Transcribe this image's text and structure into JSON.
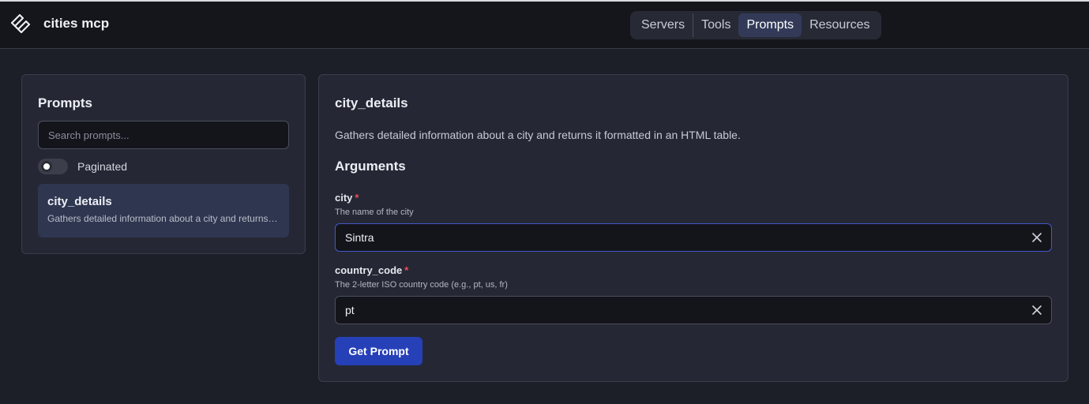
{
  "app": {
    "name": "cities mcp",
    "logo_icon": "layers-stack-icon"
  },
  "nav": {
    "items": [
      {
        "label": "Servers"
      },
      {
        "label": "Tools"
      },
      {
        "label": "Prompts"
      },
      {
        "label": "Resources"
      }
    ],
    "active": "Prompts"
  },
  "sidebar": {
    "title": "Prompts",
    "search_placeholder": "Search prompts...",
    "search_value": "",
    "paginated_label": "Paginated",
    "paginated_on": false,
    "prompts": [
      {
        "name": "city_details",
        "description": "Gathers detailed information about a city and returns it formatted in an HTML table."
      }
    ]
  },
  "detail": {
    "title": "city_details",
    "description": "Gathers detailed information about a city and returns it formatted in an HTML table.",
    "arguments_title": "Arguments",
    "arguments": [
      {
        "name": "city",
        "required_mark": "*",
        "help": "The name of the city",
        "value": "Sintra"
      },
      {
        "name": "country_code",
        "required_mark": "*",
        "help": "The 2-letter ISO country code (e.g., pt, us, fr)",
        "value": "pt"
      }
    ],
    "submit_label": "Get Prompt"
  },
  "colors": {
    "background": "#1c1e28",
    "topbar": "#15161c",
    "panel": "#252834",
    "accent": "#2640b8",
    "active_nav": "#323a58",
    "required": "#f04c5a"
  }
}
